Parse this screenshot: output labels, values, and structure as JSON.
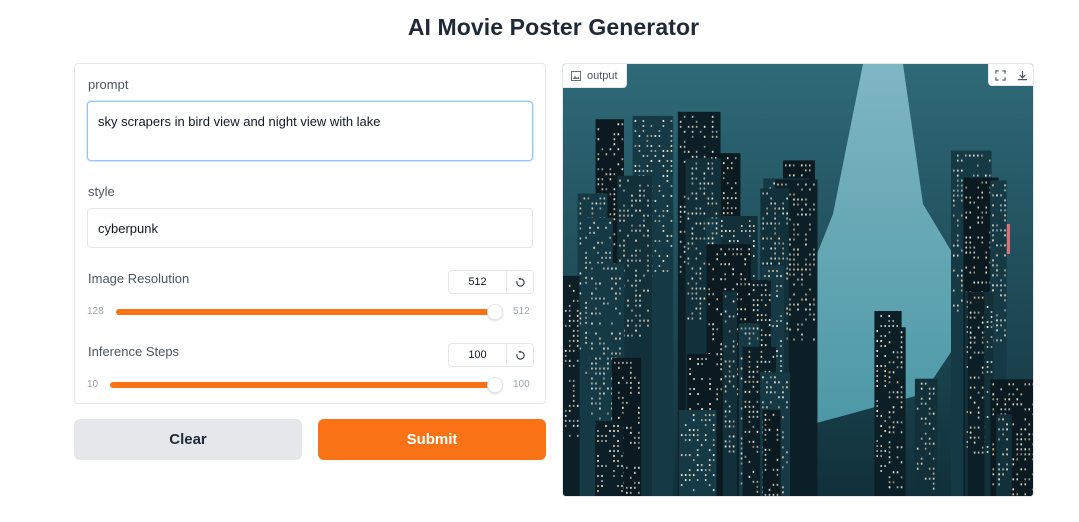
{
  "app": {
    "title": "AI Movie Poster Generator"
  },
  "form": {
    "prompt": {
      "label": "prompt",
      "value": "sky scrapers in bird view and night view with lake"
    },
    "style": {
      "label": "style",
      "value": "cyberpunk"
    },
    "resolution": {
      "label": "Image Resolution",
      "value": "512",
      "min": "128",
      "max": "512",
      "fraction": 1.0
    },
    "steps": {
      "label": "Inference Steps",
      "value": "100",
      "min": "10",
      "max": "100",
      "fraction": 1.0
    }
  },
  "actions": {
    "clear_label": "Clear",
    "submit_label": "Submit"
  },
  "output": {
    "label": "output",
    "image_alt": "generated city night skyline with lake"
  },
  "icons": {
    "reset": "reset-icon",
    "image": "image-icon",
    "fullscreen": "fullscreen-icon",
    "download": "download-icon"
  },
  "colors": {
    "accent": "#f97316",
    "border": "#e5e7eb",
    "clear_bg": "#e5e7eb"
  }
}
